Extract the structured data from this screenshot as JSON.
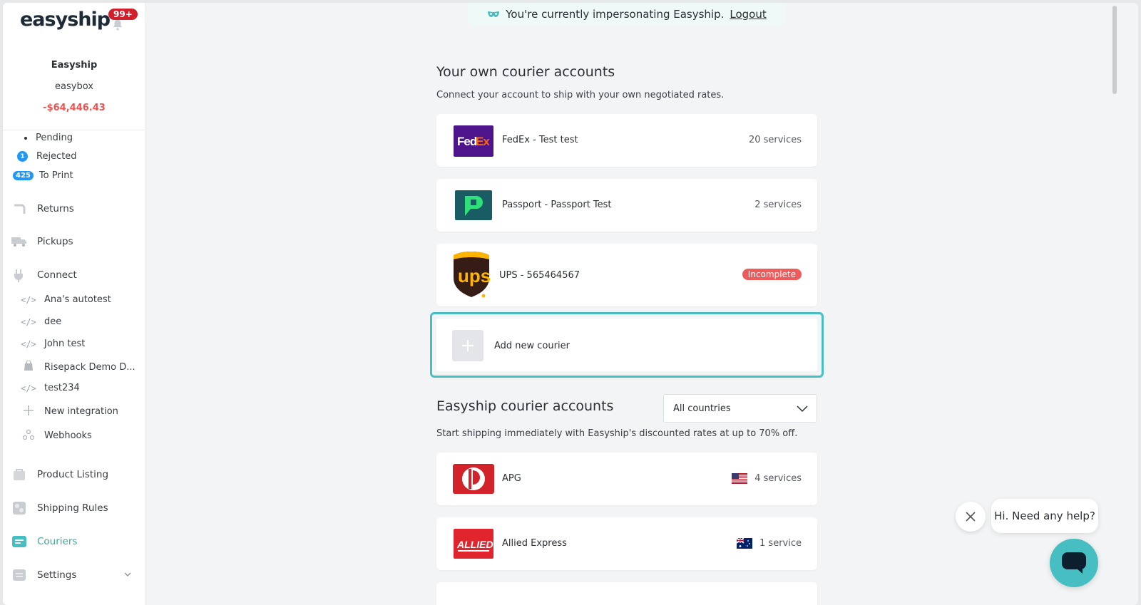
{
  "sidebar": {
    "brand": "easyship",
    "notification_count": "99+",
    "account_name": "Easyship",
    "account_sub": "easybox",
    "balance": "-$64,446.43",
    "sub_items": [
      {
        "label": "Pending"
      },
      {
        "label": "Rejected",
        "count": "1"
      },
      {
        "label": "To Print",
        "count": "425"
      }
    ],
    "nav": {
      "returns": "Returns",
      "pickups": "Pickups",
      "connect": "Connect",
      "product_listing": "Product Listing",
      "shipping_rules": "Shipping Rules",
      "couriers": "Couriers",
      "settings": "Settings"
    },
    "integrations": [
      {
        "label": "Ana's autotest",
        "icon": "code-icon"
      },
      {
        "label": "dee",
        "icon": "code-icon"
      },
      {
        "label": "John test",
        "icon": "code-icon"
      },
      {
        "label": "Risepack Demo D...",
        "icon": "shopify-bag-icon"
      },
      {
        "label": "test234",
        "icon": "code-icon"
      },
      {
        "label": "New integration",
        "icon": "plus-icon"
      },
      {
        "label": "Webhooks",
        "icon": "webhooks-icon"
      }
    ],
    "accent_color": "#3aa5a5"
  },
  "banner": {
    "text": "You're currently impersonating Easyship.",
    "logout": "Logout"
  },
  "own_accounts": {
    "title": "Your own courier accounts",
    "description": "Connect your account to ship with your own negotiated rates.",
    "couriers": [
      {
        "name": "FedEx - Test test",
        "meta": "20 services",
        "logo": "fedex-logo"
      },
      {
        "name": "Passport - Passport Test",
        "meta": "2 services",
        "logo": "passport-logo"
      },
      {
        "name": "UPS - 565464567",
        "status": "Incomplete",
        "logo": "ups-logo"
      }
    ],
    "add_label": "Add new courier"
  },
  "easyship_accounts": {
    "title": "Easyship courier accounts",
    "filter_value": "All countries",
    "description": "Start shipping immediately with Easyship's discounted rates at up to 70% off.",
    "couriers": [
      {
        "name": "APG",
        "meta": "4 services",
        "flag": "us-flag-icon",
        "logo": "apg-logo"
      },
      {
        "name": "Allied Express",
        "meta": "1 service",
        "flag": "au-flag-icon",
        "logo": "allied-express-logo"
      }
    ]
  },
  "help": {
    "bubble_text": "Hi. Need any help?"
  }
}
